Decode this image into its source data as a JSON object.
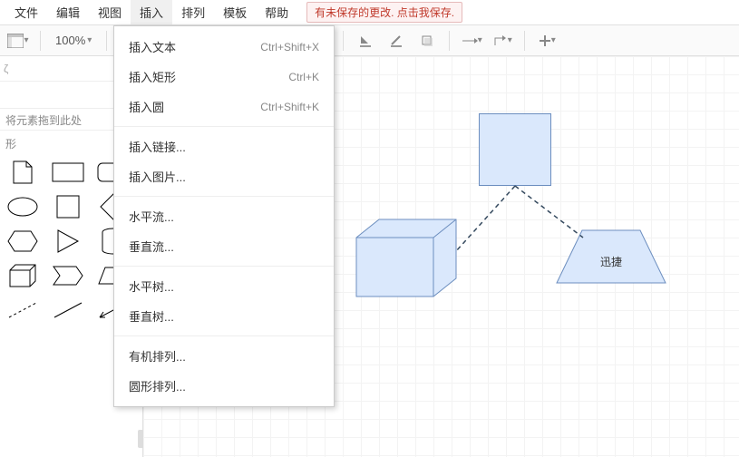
{
  "menubar": {
    "items": [
      "文件",
      "编辑",
      "视图",
      "插入",
      "排列",
      "模板",
      "帮助"
    ],
    "activeIndex": 3,
    "unsaved": "有未保存的更改. 点击我保存."
  },
  "toolbar": {
    "zoom": "100%"
  },
  "sidebar": {
    "search_placeholder": "ζ",
    "drop_hint": "将元素拖到此处",
    "section": "形"
  },
  "dropdown": {
    "group1": [
      {
        "label": "插入文本",
        "shortcut": "Ctrl+Shift+X"
      },
      {
        "label": "插入矩形",
        "shortcut": "Ctrl+K"
      },
      {
        "label": "插入圆",
        "shortcut": "Ctrl+Shift+K"
      }
    ],
    "group2": [
      {
        "label": "插入链接..."
      },
      {
        "label": "插入图片..."
      }
    ],
    "group3": [
      {
        "label": "水平流..."
      },
      {
        "label": "垂直流..."
      }
    ],
    "group4": [
      {
        "label": "水平树..."
      },
      {
        "label": "垂直树..."
      }
    ],
    "group5": [
      {
        "label": "有机排列..."
      },
      {
        "label": "圆形排列..."
      }
    ]
  },
  "canvas": {
    "trapezoid_label": "迅捷"
  }
}
